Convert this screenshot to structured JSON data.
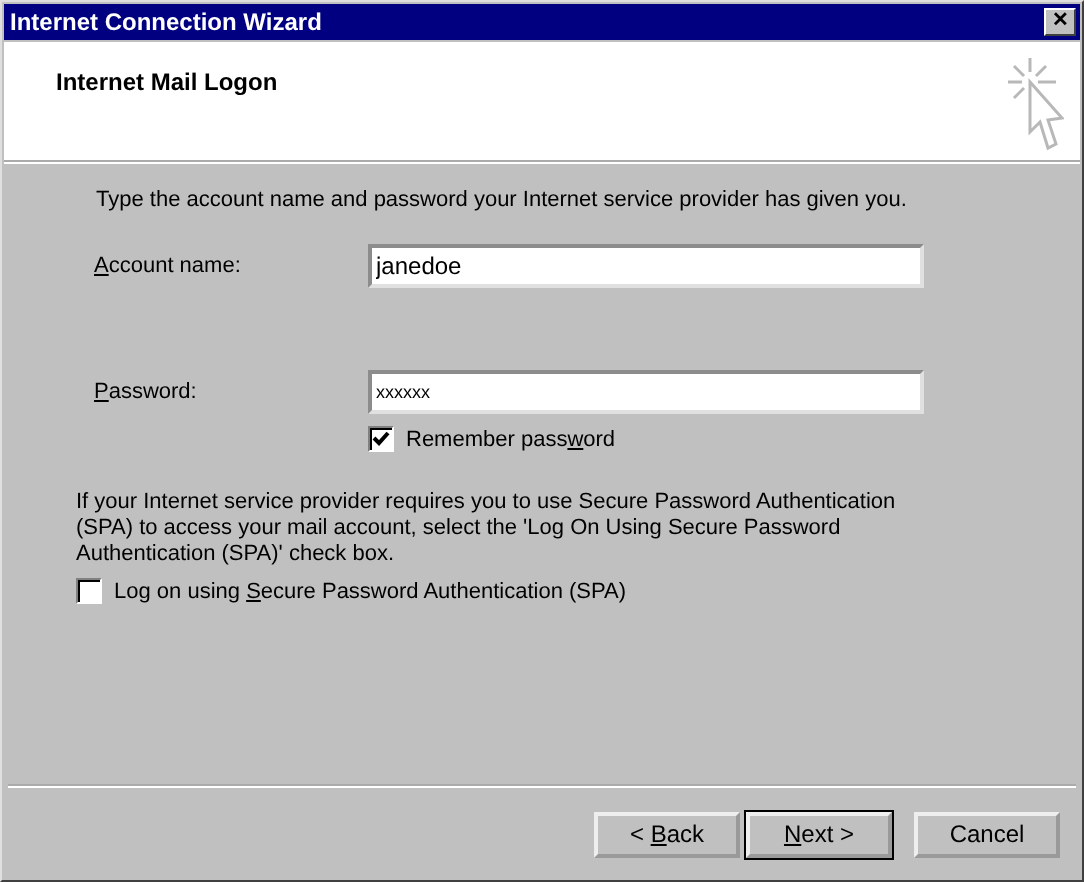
{
  "window": {
    "title": "Internet Connection Wizard",
    "close": "✕"
  },
  "header": {
    "title": "Internet Mail Logon"
  },
  "intro": "Type the account name and password your Internet service provider has given you.",
  "account": {
    "label": {
      "key": "A",
      "after": "ccount name:"
    },
    "value": "janedoe"
  },
  "password": {
    "label": {
      "key": "P",
      "after": "assword:"
    },
    "value": "xxxxxx"
  },
  "remember": {
    "label": {
      "before": "Remember pass",
      "key": "w",
      "after": "ord"
    },
    "checked": true
  },
  "spa_note": "If your Internet service provider requires you to use Secure Password Authentication (SPA) to access your mail account, select the 'Log On Using Secure Password Authentication (SPA)' check box.",
  "spa": {
    "label": {
      "before": "Log on using ",
      "key": "S",
      "after": "ecure Password Authentication (SPA)"
    },
    "checked": false
  },
  "buttons": [
    {
      "label": {
        "before": "< ",
        "key": "B",
        "after": "ack"
      },
      "default": false
    },
    {
      "label": {
        "key": "N",
        "after": "ext >"
      },
      "default": true
    },
    {
      "label": {
        "before": "Cancel"
      },
      "default": false
    }
  ]
}
